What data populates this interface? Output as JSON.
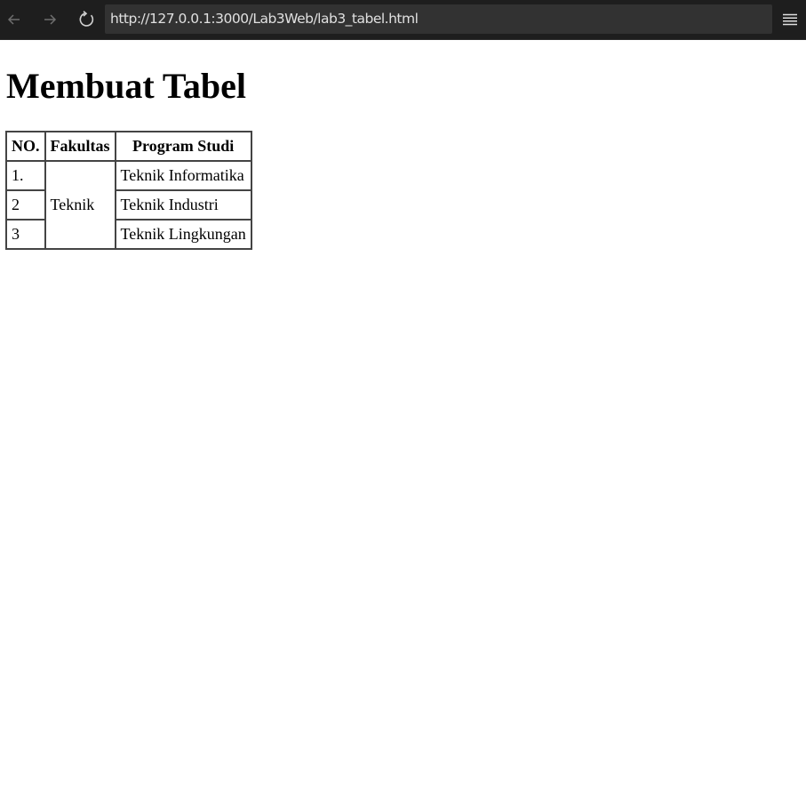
{
  "browser": {
    "url": "http://127.0.0.1:3000/Lab3Web/lab3_tabel.html",
    "icons": {
      "back": "arrow-left-icon",
      "forward": "arrow-right-icon",
      "reload": "reload-icon",
      "menu": "hamburger-menu-icon"
    },
    "colors": {
      "toolbar_bg": "#1e1e1e",
      "urlbar_bg": "#323232",
      "url_text": "#e0e0e0"
    }
  },
  "page": {
    "title": "Membuat Tabel",
    "table": {
      "headers": [
        "NO.",
        "Fakultas",
        "Program Studi"
      ],
      "rows": [
        {
          "no": "1.",
          "program": "Teknik Informatika"
        },
        {
          "no": "2",
          "program": "Teknik Industri"
        },
        {
          "no": "3",
          "program": "Teknik Lingkungan"
        }
      ],
      "fakultas_merged": "Teknik"
    }
  }
}
